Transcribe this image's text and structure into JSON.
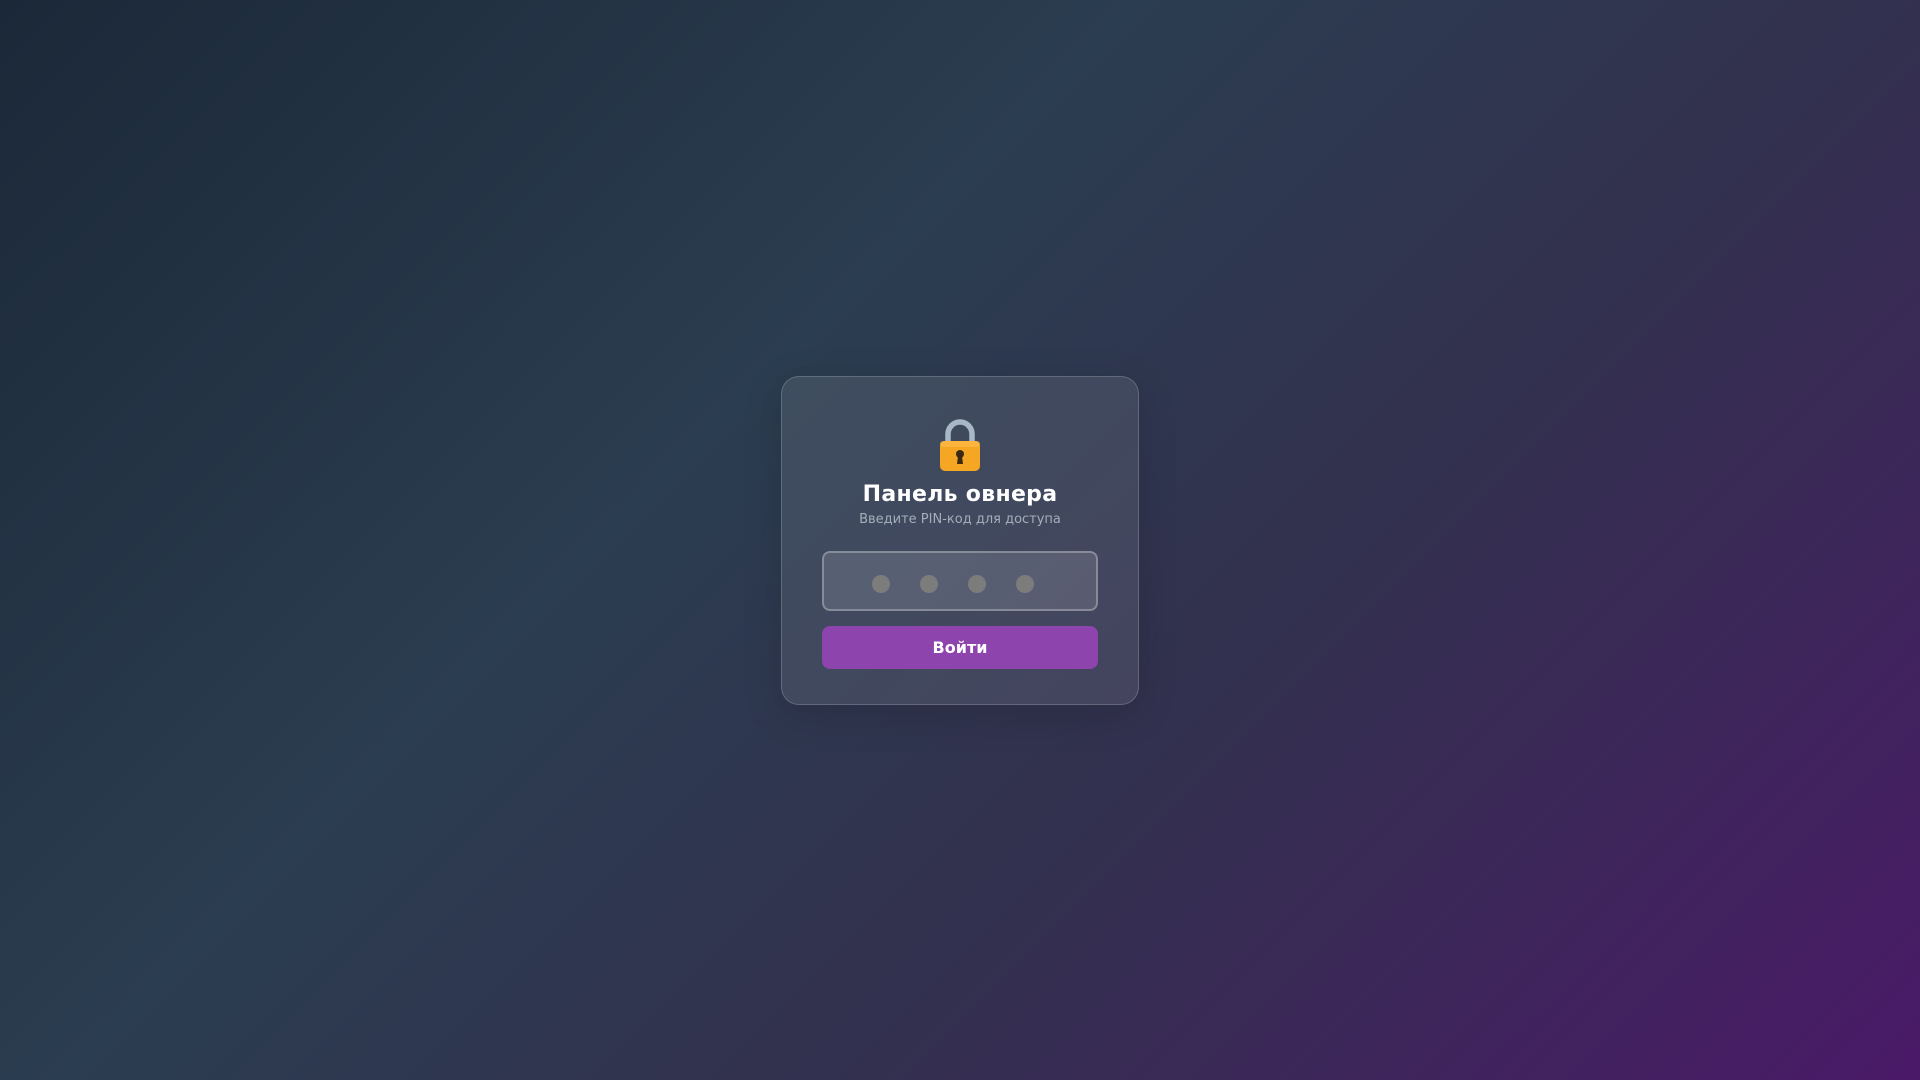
{
  "login": {
    "icon": "lock-icon",
    "title": "Панель овнера",
    "subtitle": "Введите PIN-код для доступа",
    "pin": {
      "length": 4,
      "entered": 0
    },
    "submit_label": "Войти"
  },
  "colors": {
    "accent": "#8e44ad",
    "lock_body": "#f5a623",
    "lock_shackle": "#a8b8c8",
    "pin_dot": "#7d7c7d"
  }
}
